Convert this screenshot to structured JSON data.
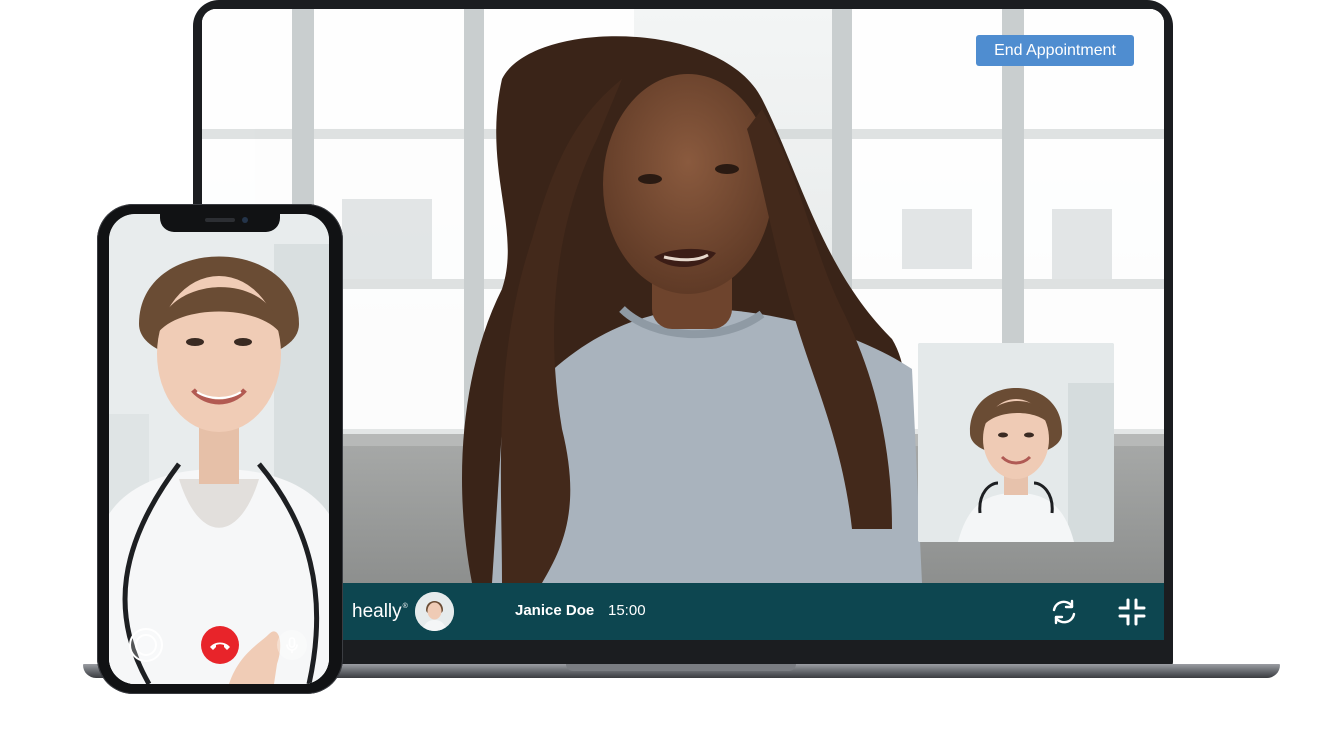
{
  "app": {
    "brand": "heally",
    "brand_mark": "®"
  },
  "video": {
    "end_button_label": "End Appointment"
  },
  "call_bar": {
    "caller_name": "Janice Doe",
    "timer": "15:00",
    "icons": [
      "avatar",
      "switch-camera-icon",
      "collapse-icon"
    ]
  },
  "phone": {
    "controls": [
      "record-icon",
      "hang-up-icon",
      "microphone-icon"
    ]
  },
  "colors": {
    "callbar_bg": "#0d4650",
    "end_button": "#4f8dd0",
    "hang_up": "#e8242a"
  }
}
